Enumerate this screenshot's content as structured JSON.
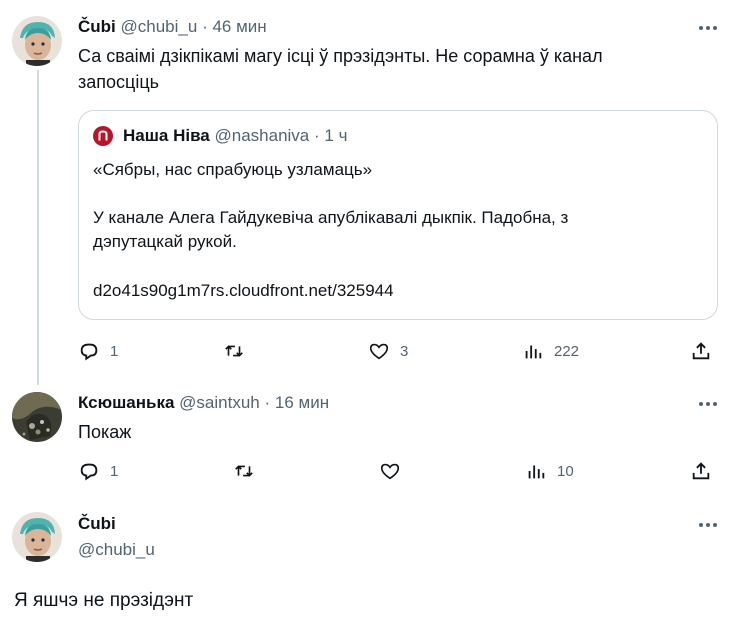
{
  "tweet1": {
    "name": "Čubi",
    "handle": "@chubi_u",
    "dot": "·",
    "time": "46 мин",
    "text_line1": "Са сваімі дзікпікамі магу ісці ў прэзідэнты. Не сорамна ў канал",
    "text_line2": "запосціць",
    "quote": {
      "name": "Наша Ніва",
      "handle": "@nashaniva",
      "dot": "·",
      "time": "1 ч",
      "line1": "«Сябры, нас спрабуюць узламаць»",
      "line2": "У канале Алега Гайдукевіча апублікавалі дыкпік. Падобна, з",
      "line3": "дэпутацкай рукой.",
      "link": "d2o41s90g1m7rs.cloudfront.net/325944"
    },
    "actions": {
      "replies": "1",
      "likes": "3",
      "views": "222"
    }
  },
  "tweet2": {
    "name": "Ксюшанька",
    "handle": "@saintxuh",
    "dot": "·",
    "time": "16 мин",
    "text": "Покаж",
    "actions": {
      "replies": "1",
      "views": "10"
    }
  },
  "tweet3": {
    "name": "Čubi",
    "handle": "@chubi_u",
    "text": "Я яшчэ не прэзідэнт"
  },
  "colors": {
    "text": "#0f1419",
    "secondary": "#536471",
    "border": "#cfd9de",
    "avatar_teal": "#4fb3b0",
    "quote_logo": "#b5162b"
  },
  "icons": [
    "more-icon",
    "reply-icon",
    "retweet-icon",
    "like-icon",
    "views-icon",
    "share-icon"
  ]
}
